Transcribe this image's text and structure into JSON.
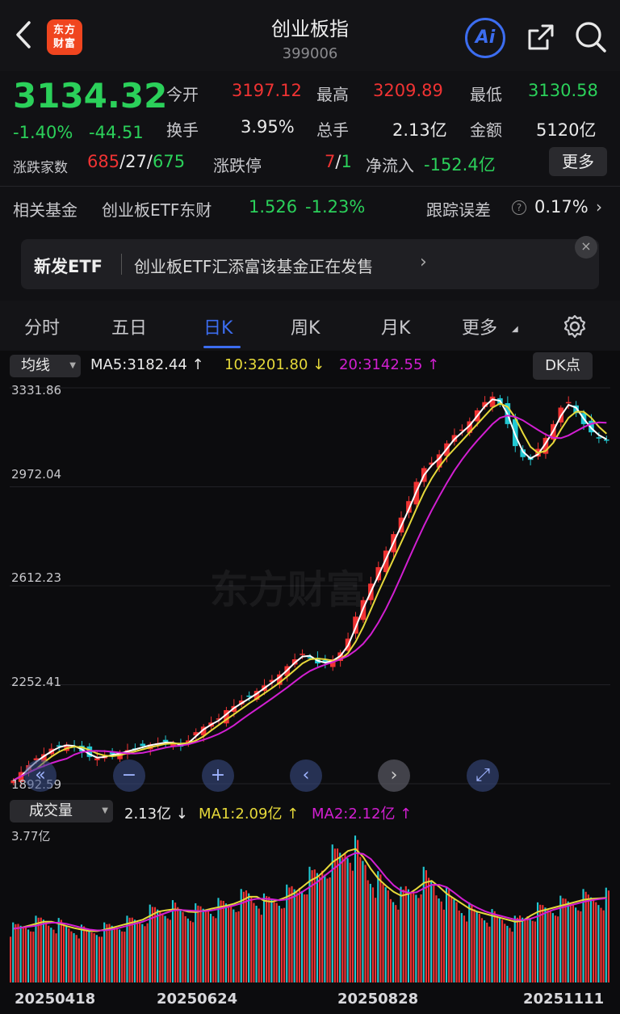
{
  "header": {
    "back_icon": "chevron-left-icon",
    "logo_text": "东方\n财富",
    "title": "创业板指",
    "code": "399006",
    "ai_label": "Ai",
    "share_icon": "share-icon",
    "search_icon": "search-icon",
    "colors": {
      "brand": "#f0451f",
      "accent": "#3c6df0",
      "up": "#f03333",
      "down": "#2bd05a"
    }
  },
  "quote": {
    "price": "3134.32",
    "change_pct": "-1.40%",
    "change_abs": "-44.51",
    "open_label": "今开",
    "open": "3197.12",
    "high_label": "最高",
    "high": "3209.89",
    "low_label": "最低",
    "low": "3130.58",
    "turnover_label": "换手",
    "turnover": "3.95%",
    "volume_label": "总手",
    "volume": "2.13亿",
    "amount_label": "金额",
    "amount": "5120亿",
    "breadth_label": "涨跌家数",
    "breadth_up": "685",
    "breadth_flat": "27",
    "breadth_down": "675",
    "limit_label": "涨跌停",
    "limit_up": "7",
    "limit_down": "1",
    "netflow_label": "净流入",
    "netflow": "-152.4亿",
    "more_label": "更多"
  },
  "fund": {
    "label": "相关基金",
    "name": "创业板ETF东财",
    "price": "1.526",
    "change": "-1.23%",
    "tracking_label": "跟踪误差",
    "tracking": "0.17%"
  },
  "banner": {
    "tag": "新发ETF",
    "text": "创业板ETF汇添富该基金正在发售",
    "close_icon": "close-icon"
  },
  "tabs": [
    "分时",
    "五日",
    "日K",
    "周K",
    "月K",
    "更多"
  ],
  "active_tab": "日K",
  "kline": {
    "ma_selector": "均线",
    "ma5": "MA5:3182.44",
    "ma10": "10:3201.80",
    "ma20": "20:3142.55",
    "dk_label": "DK点",
    "y_labels": [
      "3331.86",
      "2972.04",
      "2612.23",
      "2252.41",
      "1892.59"
    ],
    "watermark": "东方财富",
    "volume_selector": "成交量",
    "vol_now": "2.13亿",
    "vol_ma1": "MA1:2.09亿",
    "vol_ma2": "MA2:2.12亿",
    "vol_max": "3.77亿",
    "dates": [
      "20250418",
      "20250624",
      "20250828",
      "20251111"
    ]
  },
  "chart_data": {
    "type": "line",
    "title": "",
    "series": [
      {
        "name": "MA5",
        "color": "#ffffff"
      },
      {
        "name": "10",
        "color": "#e6d93a"
      },
      {
        "name": "20",
        "color": "#d21fd2"
      }
    ],
    "close_trend": [
      1905,
      1935,
      1960,
      1985,
      2000,
      2020,
      2030,
      2035,
      2025,
      2010,
      1990,
      1985,
      1995,
      2000,
      2005,
      2015,
      2020,
      2030,
      2035,
      2040,
      2045,
      2038,
      2030,
      2050,
      2080,
      2100,
      2115,
      2130,
      2160,
      2175,
      2195,
      2210,
      2230,
      2250,
      2270,
      2290,
      2320,
      2345,
      2365,
      2350,
      2330,
      2335,
      2345,
      2370,
      2420,
      2500,
      2560,
      2620,
      2680,
      2740,
      2800,
      2860,
      2920,
      2990,
      3040,
      3060,
      3090,
      3130,
      3160,
      3180,
      3210,
      3250,
      3280,
      3300,
      3270,
      3200,
      3120,
      3080,
      3070,
      3110,
      3150,
      3200,
      3260,
      3280,
      3240,
      3200,
      3170,
      3150,
      3140
    ],
    "ylim": [
      1892.59,
      3331.86
    ],
    "volume_trend": [
      1.35,
      1.4,
      1.45,
      1.5,
      1.55,
      1.5,
      1.45,
      1.38,
      1.35,
      1.3,
      1.28,
      1.3,
      1.35,
      1.4,
      1.45,
      1.5,
      1.55,
      1.6,
      1.75,
      1.8,
      1.82,
      1.85,
      1.8,
      1.75,
      1.78,
      1.82,
      1.88,
      1.9,
      1.95,
      2.0,
      2.1,
      2.2,
      2.1,
      2.0,
      2.05,
      2.1,
      2.2,
      2.3,
      2.5,
      2.6,
      2.7,
      2.95,
      3.1,
      3.2,
      3.4,
      3.3,
      3.0,
      2.7,
      2.5,
      2.35,
      2.2,
      2.15,
      2.3,
      2.4,
      2.6,
      2.5,
      2.3,
      2.15,
      2.05,
      1.9,
      1.8,
      1.75,
      1.7,
      1.65,
      1.6,
      1.55,
      1.5,
      1.6,
      1.75,
      1.8,
      1.85,
      1.9,
      1.95,
      2.0,
      2.05,
      2.1,
      2.1,
      2.12,
      2.13
    ],
    "vol_ylim": [
      0,
      3.77
    ]
  }
}
